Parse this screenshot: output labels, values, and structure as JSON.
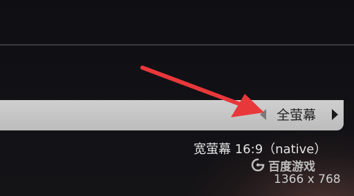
{
  "display_setting": {
    "value": "全萤幕",
    "prev_icon": "triangle-left-icon",
    "next_icon": "triangle-right-icon"
  },
  "info": {
    "aspect_label": "宽萤幕 16:9（native）",
    "screen_resolution": "1366 x 768"
  },
  "watermark": {
    "text": "百度游戏",
    "icon": "baidu-logo-icon"
  },
  "colors": {
    "annotation_arrow": "#e8383a",
    "row_background": "#c6c6c6"
  }
}
